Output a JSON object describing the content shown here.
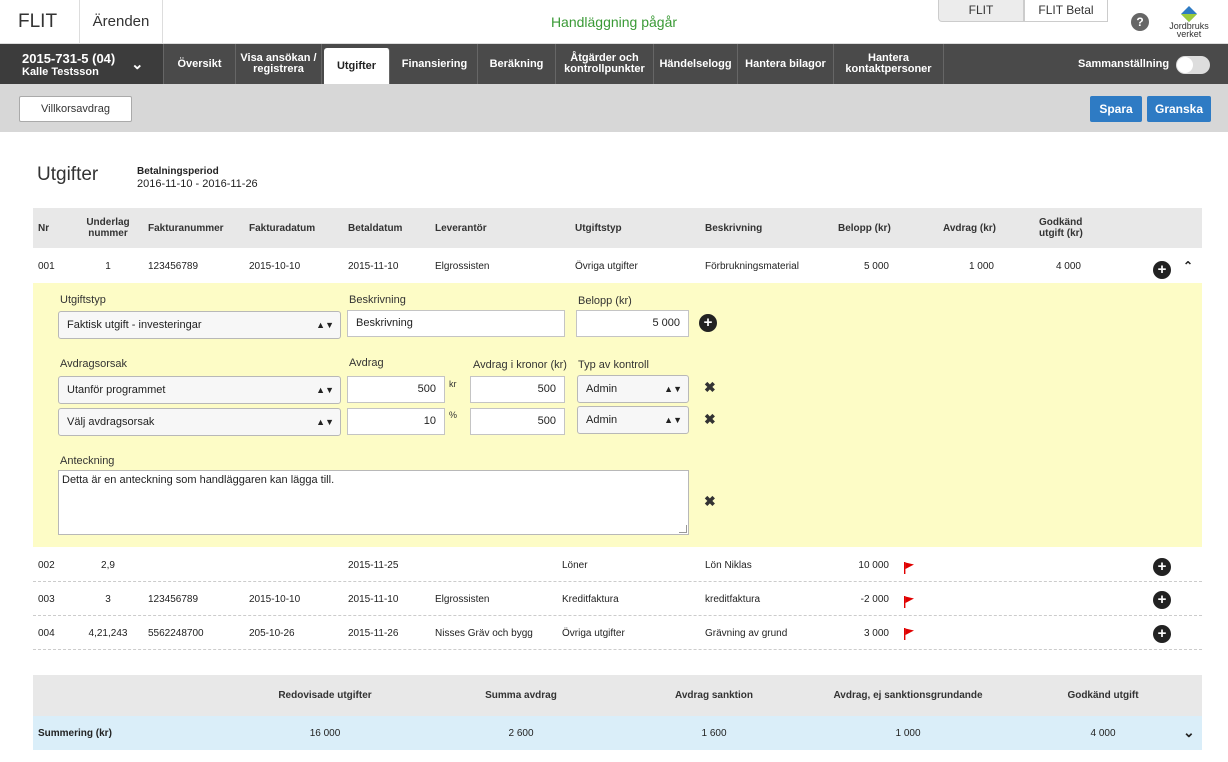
{
  "topbar": {
    "logo": "FLIT",
    "arenden": "Ärenden",
    "status": "Handläggning pågår",
    "app_tabs": [
      "FLIT",
      "FLIT Betal"
    ],
    "help": "?",
    "org_logo_text": "Jordbruks verket",
    "colors": {
      "status": "#3a9a36",
      "nav_bg": "#4a4a4a",
      "primary_button": "#2e7bc4",
      "detail_bg": "#fdfcc6",
      "summary_row": "#daeef9",
      "flag": "#e00000"
    }
  },
  "case": {
    "id": "2015-731-5 (04)",
    "name": "Kalle Testsson",
    "chevron": "chevron-down-icon"
  },
  "nav": {
    "tabs": [
      {
        "line1": "Översikt",
        "line2": ""
      },
      {
        "line1": "Visa ansökan /",
        "line2": "registrera"
      },
      {
        "line1": "Utgifter",
        "line2": ""
      },
      {
        "line1": "Finansiering",
        "line2": ""
      },
      {
        "line1": "Beräkning",
        "line2": ""
      },
      {
        "line1": "Åtgärder och",
        "line2": "kontrollpunkter"
      },
      {
        "line1": "Händelselogg",
        "line2": ""
      },
      {
        "line1": "Hantera bilagor",
        "line2": ""
      },
      {
        "line1": "Hantera",
        "line2": "kontaktpersoner"
      }
    ],
    "active": "Utgifter",
    "summary_toggle": "Sammanställning",
    "summary_toggle_on": false
  },
  "toolbar": {
    "villkor": "Villkorsavdrag",
    "save": "Spara",
    "review": "Granska"
  },
  "page": {
    "title": "Utgifter",
    "period_label": "Betalningsperiod",
    "period_value": "2016-11-10 - 2016-11-26"
  },
  "table": {
    "headers": {
      "nr": "Nr",
      "underlag1": "Underlag",
      "underlag2": "nummer",
      "fakturanummer": "Fakturanummer",
      "fakturadatum": "Fakturadatum",
      "betaldatum": "Betaldatum",
      "leverantor": "Leverantör",
      "utgiftstyp": "Utgiftstyp",
      "beskrivning": "Beskrivning",
      "belopp": "Belopp (kr)",
      "avdrag": "Avdrag (kr)",
      "godkand1": "Godkänd",
      "godkand2": "utgift (kr)"
    },
    "rows": [
      {
        "nr": "001",
        "underlag": "1",
        "fakturanummer": "123456789",
        "fakturadatum": "2015-10-10",
        "betaldatum": "2015-11-10",
        "leverantor": "Elgrossisten",
        "utgiftstyp": "Övriga utgifter",
        "beskrivning": "Förbrukningsmaterial",
        "belopp": "5 000",
        "avdrag": "1 000",
        "godkand": "4 000",
        "flag": false
      },
      {
        "nr": "002",
        "underlag": "2,9",
        "fakturanummer": "",
        "fakturadatum": "",
        "betaldatum": "2015-11-25",
        "leverantor": "",
        "utgiftstyp": "Löner",
        "beskrivning": "Lön Niklas",
        "belopp": "10 000",
        "avdrag": "",
        "godkand": "",
        "flag": true
      },
      {
        "nr": "003",
        "underlag": "3",
        "fakturanummer": "123456789",
        "fakturadatum": "2015-10-10",
        "betaldatum": "2015-11-10",
        "leverantor": "Elgrossisten",
        "utgiftstyp": "Kreditfaktura",
        "beskrivning": "kreditfaktura",
        "belopp": "-2 000",
        "avdrag": "",
        "godkand": "",
        "flag": true
      },
      {
        "nr": "004",
        "underlag": "4,21,243",
        "fakturanummer": "5562248700",
        "fakturadatum": "205-10-26",
        "betaldatum": "2015-11-26",
        "leverantor": "Nisses Gräv och bygg",
        "utgiftstyp": "Övriga utgifter",
        "beskrivning": "Grävning av grund",
        "belopp": "3 000",
        "avdrag": "",
        "godkand": "",
        "flag": true
      }
    ]
  },
  "detail": {
    "utgiftstyp_label": "Utgiftstyp",
    "utgiftstyp_value": "Faktisk utgift - investeringar",
    "beskrivning_label": "Beskrivning",
    "beskrivning_value": "Beskrivning",
    "belopp_label": "Belopp (kr)",
    "belopp_value": "5 000",
    "avdragsorsak_label": "Avdragsorsak",
    "avdrag_label": "Avdrag",
    "avdrag_kr_label": "Avdrag i kronor (kr)",
    "typ_label": "Typ av kontroll",
    "deductions": [
      {
        "orsak": "Utanför programmet",
        "avdrag": "500",
        "unit": "kr",
        "kronor": "500",
        "typ": "Admin"
      },
      {
        "orsak": "Välj avdragsorsak",
        "avdrag": "10",
        "unit": "%",
        "kronor": "500",
        "typ": "Admin"
      }
    ],
    "anteckning_label": "Anteckning",
    "anteckning_value": "Detta är en anteckning som handläggaren kan lägga till."
  },
  "summary": {
    "headers": [
      "Redovisade utgifter",
      "Summa avdrag",
      "Avdrag sanktion",
      "Avdrag, ej sanktionsgrundande",
      "Godkänd utgift"
    ],
    "label": "Summering (kr)",
    "values": [
      "16 000",
      "2 600",
      "1 600",
      "1 000",
      "4 000"
    ]
  }
}
